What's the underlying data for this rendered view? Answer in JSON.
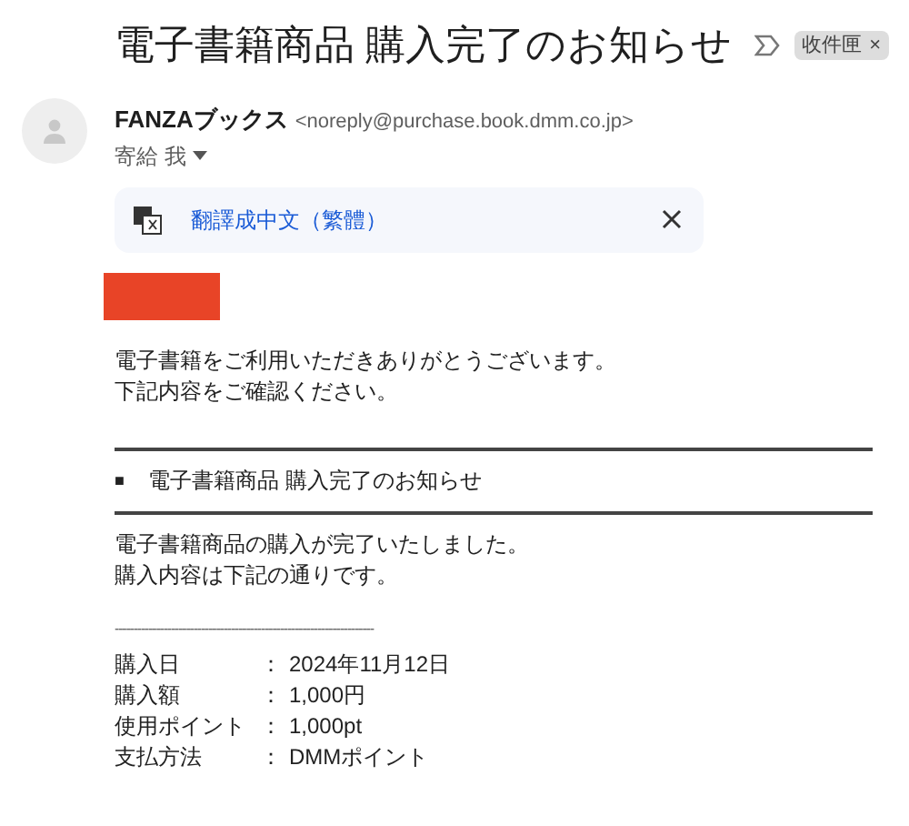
{
  "subject": "電子書籍商品 購入完了のお知らせ",
  "label_chip": {
    "text": "收件匣",
    "close": "×"
  },
  "sender": {
    "name": "FANZAブックス",
    "address": "<noreply@purchase.book.dmm.co.jp>",
    "recipient": "寄給 我"
  },
  "translate_bar": {
    "link": "翻譯成中文（繁體）"
  },
  "greeting": [
    "電子書籍をご利用いただきありがとうございます。",
    "下記内容をご確認ください。"
  ],
  "section_heading": {
    "bullet": "■",
    "text": "電子書籍商品 購入完了のお知らせ"
  },
  "intro": [
    "電子書籍商品の購入が完了いたしました。",
    "購入内容は下記の通りです。"
  ],
  "separator": "---------------------------------------------------------------------",
  "details": [
    {
      "label": "購入日",
      "colon": "：",
      "value": "2024年11月12日"
    },
    {
      "label": "購入額",
      "colon": "：",
      "value": "1,000円"
    },
    {
      "label": "使用ポイント",
      "colon": "：",
      "value": "1,000pt"
    },
    {
      "label": "支払方法",
      "colon": "：",
      "value": "DMMポイント"
    }
  ]
}
